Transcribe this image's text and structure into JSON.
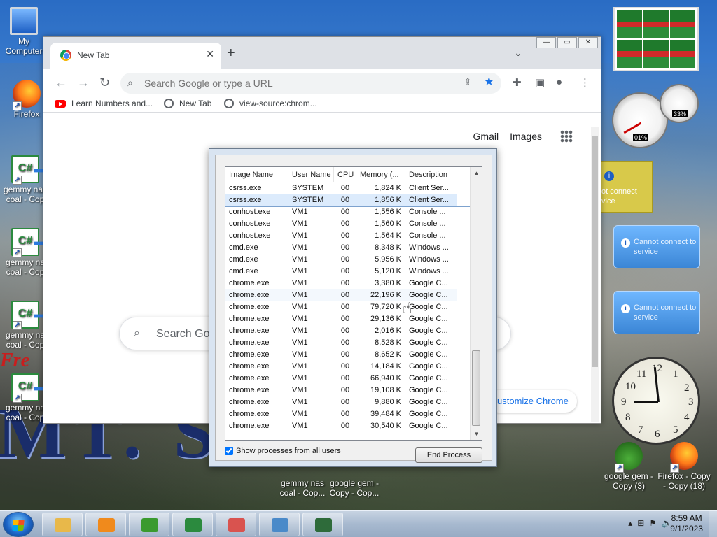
{
  "desktop": {
    "icons_left": [
      {
        "label": "My Computer",
        "kind": "computer"
      },
      {
        "label": "Firefox",
        "kind": "firefox"
      },
      {
        "label": "gemmy nas coal - Cop",
        "kind": "csharp"
      },
      {
        "label": "gemmy na coal - Cop",
        "kind": "csharp"
      },
      {
        "label": "gemmy na coal - Cop",
        "kind": "csharp"
      },
      {
        "label": "gemmy na coal - Cop",
        "kind": "csharp"
      }
    ],
    "icons_bottom": [
      {
        "label": "gemmy nas coal - Cop...",
        "kind": "csharp"
      },
      {
        "label": "google gem - Copy - Cop...",
        "kind": "frog"
      }
    ],
    "icons_right": [
      {
        "label": "google gem - Copy (3)",
        "kind": "frog"
      },
      {
        "label": "Firefox - Copy - Copy (18)",
        "kind": "firefox"
      }
    ],
    "wallpaper_big_text": "MT. S  RE",
    "wallpaper_red_text": "Fre"
  },
  "chrome": {
    "tab_title": "New Tab",
    "omnibox_placeholder": "Search Google or type a URL",
    "bookmarks": [
      "Learn Numbers and...",
      "New Tab",
      "view-source:chrom..."
    ],
    "top_links": {
      "gmail": "Gmail",
      "images": "Images"
    },
    "search_placeholder": "Search Goo",
    "customize_label": "ustomize Chrome"
  },
  "taskmgr": {
    "columns": [
      "Image Name",
      "User Name",
      "CPU",
      "Memory (...",
      "Description"
    ],
    "rows": [
      [
        "csrss.exe",
        "SYSTEM",
        "00",
        "1,824 K",
        "Client Ser..."
      ],
      [
        "csrss.exe",
        "SYSTEM",
        "00",
        "1,856 K",
        "Client Ser..."
      ],
      [
        "conhost.exe",
        "VM1",
        "00",
        "1,556 K",
        "Console ..."
      ],
      [
        "conhost.exe",
        "VM1",
        "00",
        "1,560 K",
        "Console ..."
      ],
      [
        "conhost.exe",
        "VM1",
        "00",
        "1,564 K",
        "Console ..."
      ],
      [
        "cmd.exe",
        "VM1",
        "00",
        "8,348 K",
        "Windows ..."
      ],
      [
        "cmd.exe",
        "VM1",
        "00",
        "5,956 K",
        "Windows ..."
      ],
      [
        "cmd.exe",
        "VM1",
        "00",
        "5,120 K",
        "Windows ..."
      ],
      [
        "chrome.exe",
        "VM1",
        "00",
        "3,380 K",
        "Google C..."
      ],
      [
        "chrome.exe",
        "VM1",
        "00",
        "22,196 K",
        "Google C..."
      ],
      [
        "chrome.exe",
        "VM1",
        "00",
        "79,720 K",
        "Google C..."
      ],
      [
        "chrome.exe",
        "VM1",
        "00",
        "29,136 K",
        "Google C..."
      ],
      [
        "chrome.exe",
        "VM1",
        "00",
        "2,016 K",
        "Google C..."
      ],
      [
        "chrome.exe",
        "VM1",
        "00",
        "8,528 K",
        "Google C..."
      ],
      [
        "chrome.exe",
        "VM1",
        "00",
        "8,652 K",
        "Google C..."
      ],
      [
        "chrome.exe",
        "VM1",
        "00",
        "14,184 K",
        "Google C..."
      ],
      [
        "chrome.exe",
        "VM1",
        "00",
        "66,940 K",
        "Google C..."
      ],
      [
        "chrome.exe",
        "VM1",
        "00",
        "19,108 K",
        "Google C..."
      ],
      [
        "chrome.exe",
        "VM1",
        "00",
        "9,880 K",
        "Google C..."
      ],
      [
        "chrome.exe",
        "VM1",
        "00",
        "39,484 K",
        "Google C..."
      ],
      [
        "chrome.exe",
        "VM1",
        "00",
        "30,540 K",
        "Google C..."
      ]
    ],
    "selected_row": 1,
    "hover_row": 9,
    "show_all_label": "Show processes from all users",
    "show_all_checked": true,
    "end_process_label": "End Process"
  },
  "gadgets": {
    "cpu_value": "01%",
    "mem_value": "33%",
    "weather_text": "ot connect vice",
    "service_messages": [
      "Cannot connect to service",
      "Cannot connect to service"
    ],
    "clock_numbers": [
      "12",
      "1",
      "2",
      "3",
      "4",
      "5",
      "6",
      "7",
      "8",
      "9",
      "10",
      "11"
    ]
  },
  "taskbar": {
    "time": "8:59 AM",
    "date": "9/1/2023",
    "buttons": [
      {
        "name": "explorer",
        "color": "#e8b84a"
      },
      {
        "name": "media-player",
        "color": "#f08a1c"
      },
      {
        "name": "frog-app",
        "color": "#3a9a2e"
      },
      {
        "name": "csharp-app",
        "color": "#2b8a3e"
      },
      {
        "name": "paint-app",
        "color": "#d9534f"
      },
      {
        "name": "photo-viewer",
        "color": "#4a8ac9"
      },
      {
        "name": "task-manager",
        "color": "#2e6b3a"
      }
    ]
  }
}
